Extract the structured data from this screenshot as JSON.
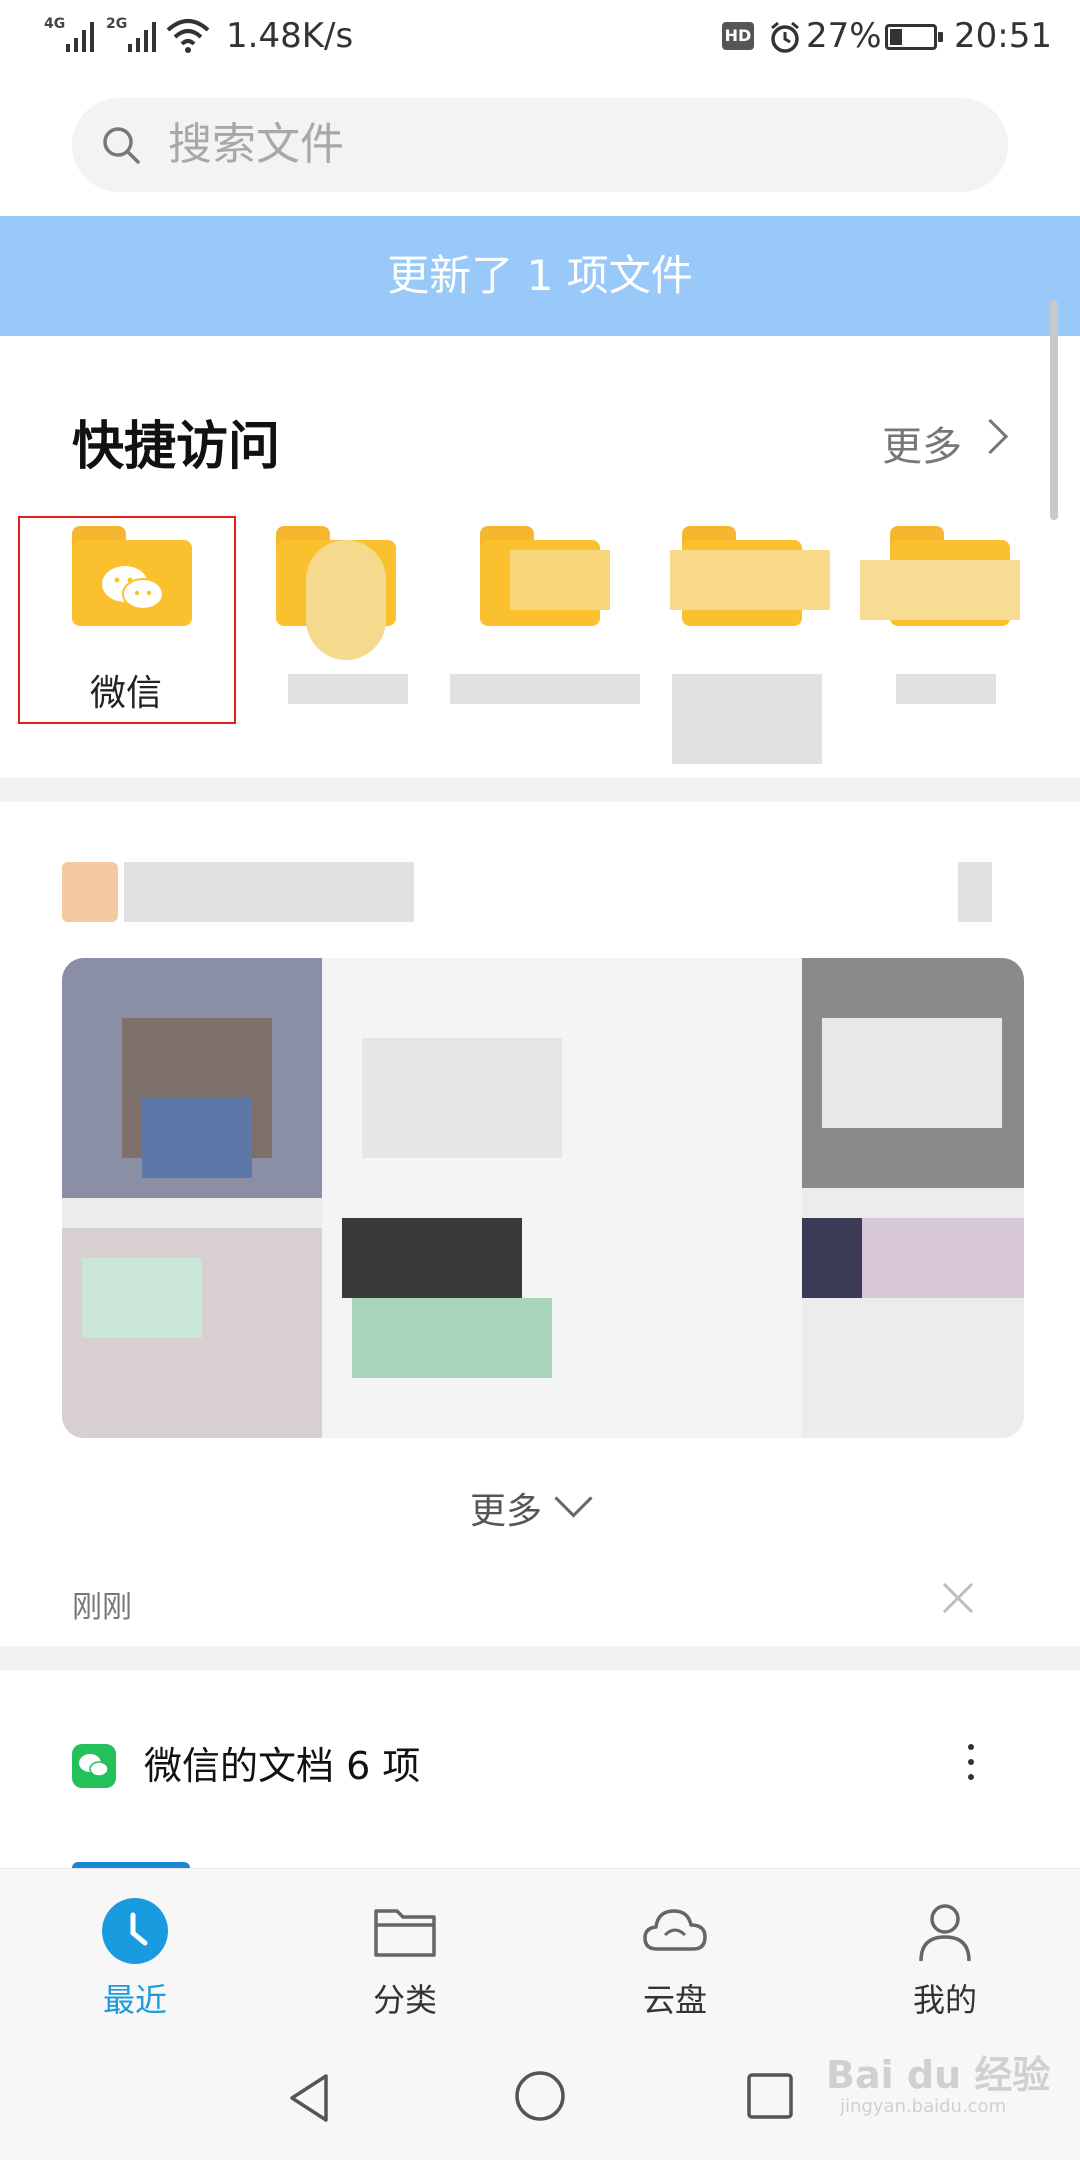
{
  "status_bar": {
    "network_1": "4G",
    "network_2": "2G",
    "speed": "1.48K/s",
    "hd": "HD",
    "battery": "27%",
    "time": "20:51"
  },
  "search": {
    "placeholder": "搜索文件",
    "icon": "search-icon"
  },
  "banner": {
    "text": "更新了 1 项文件"
  },
  "quick_access": {
    "title": "快捷访问",
    "more": "更多",
    "items": [
      {
        "label": "微信",
        "icon": "wechat-folder-icon",
        "selected": true
      },
      {
        "label": "",
        "icon": "folder-icon"
      },
      {
        "label": "",
        "icon": "folder-icon"
      },
      {
        "label": "",
        "icon": "folder-icon"
      },
      {
        "label": "",
        "icon": "folder-icon"
      }
    ]
  },
  "recent": {
    "more": "更多",
    "time": "刚刚"
  },
  "doc_group": {
    "title": "微信的文档 6 项",
    "icon": "wechat-icon"
  },
  "bottom_nav": {
    "items": [
      {
        "label": "最近",
        "icon": "clock-icon",
        "active": true
      },
      {
        "label": "分类",
        "icon": "folder-outline-icon",
        "active": false
      },
      {
        "label": "云盘",
        "icon": "cloud-icon",
        "active": false
      },
      {
        "label": "我的",
        "icon": "person-icon",
        "active": false
      }
    ]
  },
  "colors": {
    "accent": "#1a9be0",
    "banner": "#99c9f8",
    "folder": "#fbc02d",
    "selection": "#e02020"
  },
  "watermark": {
    "brand": "Bai du 经验",
    "url": "jingyan.baidu.com"
  }
}
